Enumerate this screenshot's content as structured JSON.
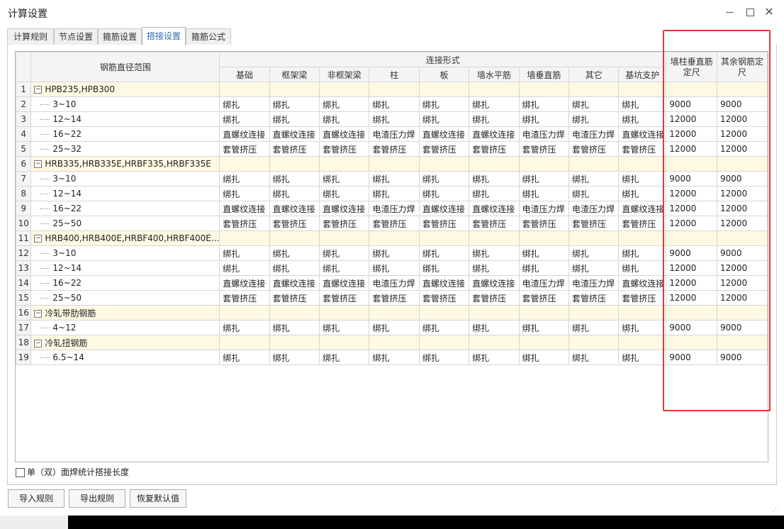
{
  "window": {
    "title": "计算设置"
  },
  "tabs": [
    {
      "label": "计算规则"
    },
    {
      "label": "节点设置"
    },
    {
      "label": "箍筋设置"
    },
    {
      "label": "搭接设置"
    },
    {
      "label": "箍筋公式"
    }
  ],
  "table": {
    "header_diameter": "钢筋直径范围",
    "header_connection": "连接形式",
    "columns": [
      "基础",
      "框架梁",
      "非框架梁",
      "柱",
      "板",
      "墙水平筋",
      "墙垂直筋",
      "其它",
      "基坑支护"
    ],
    "header_wall_col_1": "墙柱垂直筋",
    "header_wall_col_2": "定尺",
    "header_other_1": "其余钢筋定",
    "header_other_2": "尺",
    "rows": [
      {
        "no": "1",
        "group": true,
        "label": "HPB235,HPB300"
      },
      {
        "no": "2",
        "label": "3~10",
        "cells": [
          "绑扎",
          "绑扎",
          "绑扎",
          "绑扎",
          "绑扎",
          "绑扎",
          "绑扎",
          "绑扎",
          "绑扎"
        ],
        "wall": "9000",
        "other": "9000"
      },
      {
        "no": "3",
        "label": "12~14",
        "cells": [
          "绑扎",
          "绑扎",
          "绑扎",
          "绑扎",
          "绑扎",
          "绑扎",
          "绑扎",
          "绑扎",
          "绑扎"
        ],
        "wall": "12000",
        "other": "12000"
      },
      {
        "no": "4",
        "label": "16~22",
        "cells": [
          "直螺纹连接",
          "直螺纹连接",
          "直螺纹连接",
          "电渣压力焊",
          "直螺纹连接",
          "直螺纹连接",
          "电渣压力焊",
          "电渣压力焊",
          "直螺纹连接"
        ],
        "wall": "12000",
        "other": "12000"
      },
      {
        "no": "5",
        "label": "25~32",
        "cells": [
          "套管挤压",
          "套管挤压",
          "套管挤压",
          "套管挤压",
          "套管挤压",
          "套管挤压",
          "套管挤压",
          "套管挤压",
          "套管挤压"
        ],
        "wall": "12000",
        "other": "12000"
      },
      {
        "no": "6",
        "group": true,
        "label": "HRB335,HRB335E,HRBF335,HRBF335E"
      },
      {
        "no": "7",
        "label": "3~10",
        "cells": [
          "绑扎",
          "绑扎",
          "绑扎",
          "绑扎",
          "绑扎",
          "绑扎",
          "绑扎",
          "绑扎",
          "绑扎"
        ],
        "wall": "9000",
        "other": "9000"
      },
      {
        "no": "8",
        "label": "12~14",
        "cells": [
          "绑扎",
          "绑扎",
          "绑扎",
          "绑扎",
          "绑扎",
          "绑扎",
          "绑扎",
          "绑扎",
          "绑扎"
        ],
        "wall": "12000",
        "other": "12000"
      },
      {
        "no": "9",
        "label": "16~22",
        "cells": [
          "直螺纹连接",
          "直螺纹连接",
          "直螺纹连接",
          "电渣压力焊",
          "直螺纹连接",
          "直螺纹连接",
          "电渣压力焊",
          "电渣压力焊",
          "直螺纹连接"
        ],
        "wall": "12000",
        "other": "12000"
      },
      {
        "no": "10",
        "label": "25~50",
        "cells": [
          "套管挤压",
          "套管挤压",
          "套管挤压",
          "套管挤压",
          "套管挤压",
          "套管挤压",
          "套管挤压",
          "套管挤压",
          "套管挤压"
        ],
        "wall": "12000",
        "other": "12000"
      },
      {
        "no": "11",
        "group": true,
        "label": "HRB400,HRB400E,HRBF400,HRBF400E..."
      },
      {
        "no": "12",
        "label": "3~10",
        "cells": [
          "绑扎",
          "绑扎",
          "绑扎",
          "绑扎",
          "绑扎",
          "绑扎",
          "绑扎",
          "绑扎",
          "绑扎"
        ],
        "wall": "9000",
        "other": "9000"
      },
      {
        "no": "13",
        "label": "12~14",
        "cells": [
          "绑扎",
          "绑扎",
          "绑扎",
          "绑扎",
          "绑扎",
          "绑扎",
          "绑扎",
          "绑扎",
          "绑扎"
        ],
        "wall": "12000",
        "other": "12000"
      },
      {
        "no": "14",
        "label": "16~22",
        "cells": [
          "直螺纹连接",
          "直螺纹连接",
          "直螺纹连接",
          "电渣压力焊",
          "直螺纹连接",
          "直螺纹连接",
          "电渣压力焊",
          "电渣压力焊",
          "直螺纹连接"
        ],
        "wall": "12000",
        "other": "12000"
      },
      {
        "no": "15",
        "label": "25~50",
        "cells": [
          "套管挤压",
          "套管挤压",
          "套管挤压",
          "套管挤压",
          "套管挤压",
          "套管挤压",
          "套管挤压",
          "套管挤压",
          "套管挤压"
        ],
        "wall": "12000",
        "other": "12000"
      },
      {
        "no": "16",
        "group": true,
        "label": "冷轧带肋钢筋"
      },
      {
        "no": "17",
        "label": "4~12",
        "cells": [
          "绑扎",
          "绑扎",
          "绑扎",
          "绑扎",
          "绑扎",
          "绑扎",
          "绑扎",
          "绑扎",
          "绑扎"
        ],
        "wall": "9000",
        "other": "9000"
      },
      {
        "no": "18",
        "group": true,
        "label": "冷轧扭钢筋"
      },
      {
        "no": "19",
        "label": "6.5~14",
        "cells": [
          "绑扎",
          "绑扎",
          "绑扎",
          "绑扎",
          "绑扎",
          "绑扎",
          "绑扎",
          "绑扎",
          "绑扎"
        ],
        "wall": "9000",
        "other": "9000"
      }
    ]
  },
  "options": {
    "single_double_weld_label": "单（双）面焊统计搭接长度"
  },
  "buttons": {
    "import": "导入规则",
    "export": "导出规则",
    "restore": "恢复默认值"
  },
  "icons": {
    "minimize": "minimize-icon",
    "maximize": "maximize-icon",
    "close": "close-icon",
    "collapse": "minus-box-icon"
  },
  "colors": {
    "active_tab": "#2f6fb7",
    "group_row": "#fdf9e3",
    "highlight_box": "#e53935"
  }
}
